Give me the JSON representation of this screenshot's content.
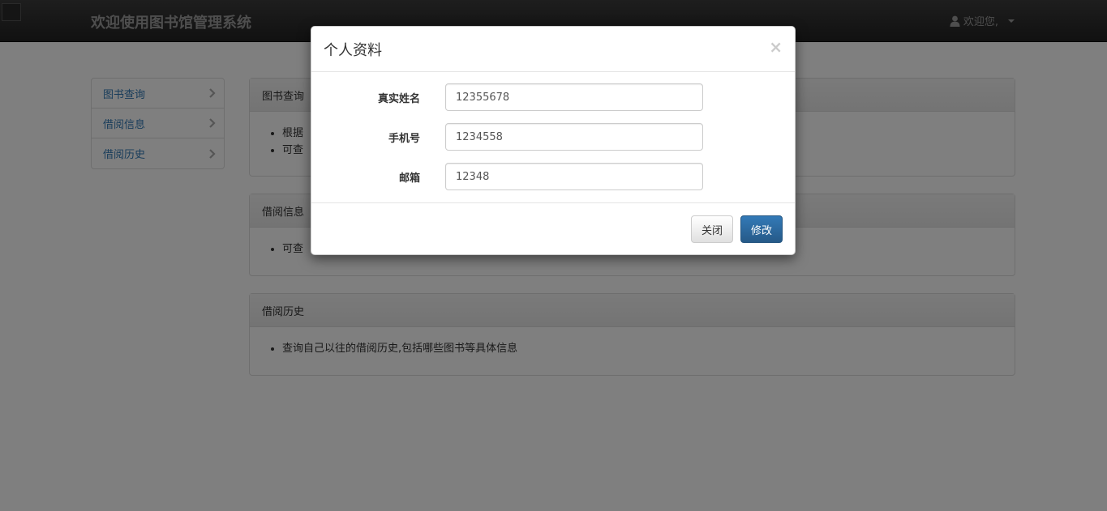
{
  "navbar": {
    "brand": "欢迎使用图书馆管理系统",
    "user_label": "欢迎您,",
    "user_icon": "user-icon",
    "caret_icon": "caret-down-icon"
  },
  "sidebar": {
    "items": [
      {
        "label": "图书查询"
      },
      {
        "label": "借阅信息"
      },
      {
        "label": "借阅历史"
      }
    ]
  },
  "panels": [
    {
      "heading": "图书查询",
      "bullets": [
        "根据",
        "可查"
      ]
    },
    {
      "heading": "借阅信息",
      "bullets": [
        "可查"
      ]
    },
    {
      "heading": "借阅历史",
      "bullets": [
        "查询自己以往的借阅历史,包括哪些图书等具体信息"
      ]
    }
  ],
  "modal": {
    "title": "个人资料",
    "close_symbol": "×",
    "fields": [
      {
        "label": "真实姓名",
        "value": "12355678"
      },
      {
        "label": "手机号",
        "value": "1234558"
      },
      {
        "label": "邮箱",
        "value": "12348"
      }
    ],
    "close_button": "关闭",
    "submit_button": "修改"
  },
  "colors": {
    "navbar_bg": "#222222",
    "link": "#337ab7",
    "primary": "#286090"
  }
}
